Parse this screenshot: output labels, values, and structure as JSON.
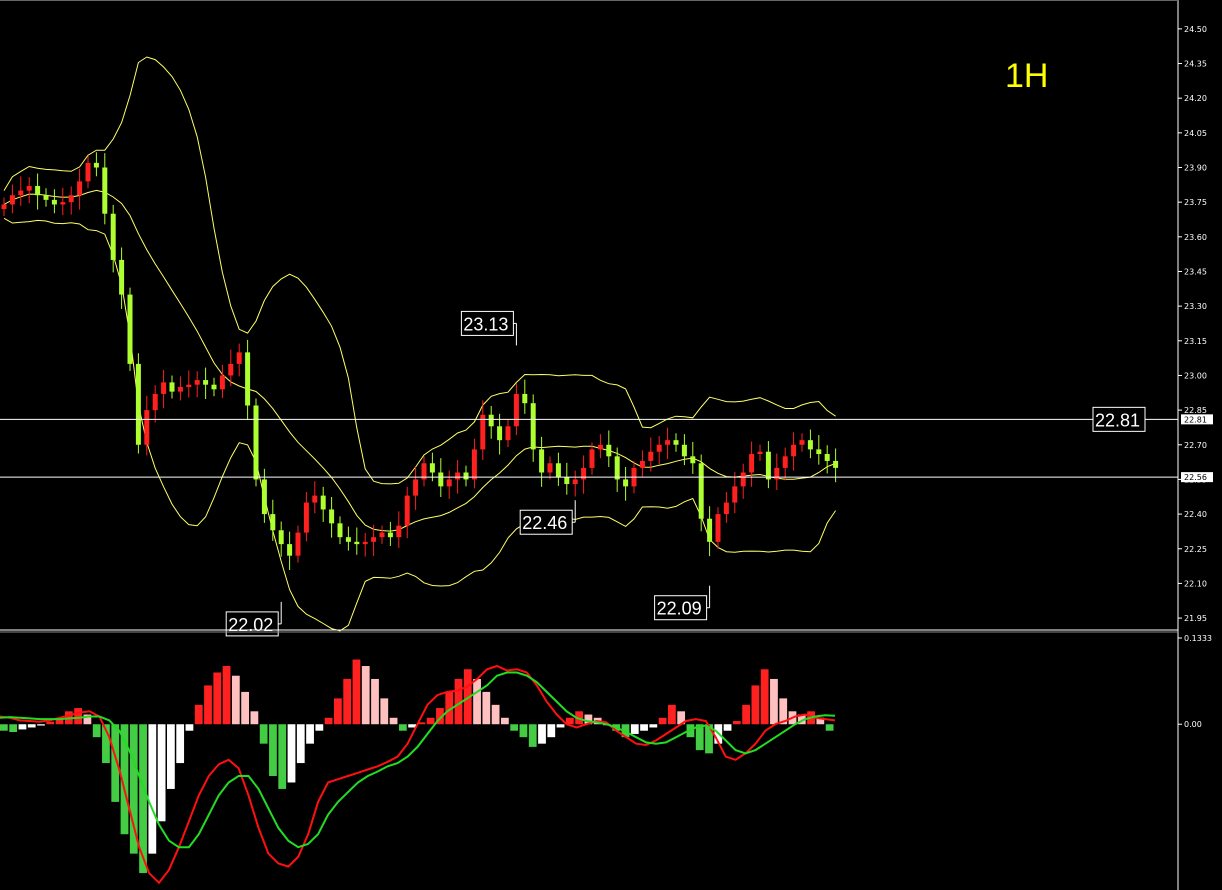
{
  "timeframe": "1H",
  "chart_data": [
    {
      "type": "candlestick",
      "title": "",
      "y_ticks": [
        24.5,
        24.35,
        24.2,
        24.05,
        23.9,
        23.75,
        23.6,
        23.45,
        23.3,
        23.15,
        23.0,
        22.85,
        22.7,
        22.55,
        22.4,
        22.25,
        22.1,
        21.95
      ],
      "ylim": [
        21.92,
        24.56
      ],
      "horizontal_lines": [
        {
          "price": 22.81,
          "label": "22.81",
          "tag": "22.81"
        },
        {
          "price": 22.56,
          "tag": "22.56"
        }
      ],
      "annotations": [
        {
          "text": "23.13",
          "price": 23.13,
          "bar": 61
        },
        {
          "text": "22.46",
          "price": 22.46,
          "bar": 68
        },
        {
          "text": "22.09",
          "price": 22.09,
          "bar": 84
        },
        {
          "text": "22.02",
          "price": 22.02,
          "bar": 33
        }
      ],
      "close_series": [
        23.74,
        23.78,
        23.8,
        23.82,
        23.78,
        23.76,
        23.74,
        23.75,
        23.78,
        23.84,
        23.92,
        23.9,
        23.7,
        23.5,
        23.35,
        23.05,
        22.7,
        22.85,
        22.92,
        22.97,
        22.93,
        22.95,
        22.96,
        22.98,
        22.96,
        22.94,
        23.0,
        23.05,
        23.1,
        22.87,
        22.55,
        22.4,
        22.33,
        22.27,
        22.22,
        22.32,
        22.45,
        22.48,
        22.42,
        22.36,
        22.3,
        22.28,
        22.27,
        22.28,
        22.3,
        22.32,
        22.3,
        22.35,
        22.48,
        22.55,
        22.62,
        22.58,
        22.52,
        22.55,
        22.58,
        22.55,
        22.68,
        22.83,
        22.78,
        22.72,
        22.78,
        22.92,
        22.88,
        22.68,
        22.58,
        22.62,
        22.56,
        22.53,
        22.55,
        22.6,
        22.68,
        22.7,
        22.65,
        22.55,
        22.52,
        22.6,
        22.63,
        22.67,
        22.7,
        22.72,
        22.7,
        22.65,
        22.62,
        22.38,
        22.28,
        22.4,
        22.45,
        22.52,
        22.58,
        22.66,
        22.67,
        22.55,
        22.6,
        22.65,
        22.7,
        22.72,
        22.68,
        22.66,
        22.63,
        22.6
      ]
    },
    {
      "type": "macd",
      "y_ticks": [
        0.1333,
        0.0
      ],
      "ylim": [
        -0.25,
        0.1333
      ],
      "macd": [
        0.012,
        0.01,
        0.006,
        0.005,
        0.004,
        0.006,
        0.01,
        0.014,
        0.018,
        0.02,
        0.012,
        -0.02,
        -0.07,
        -0.13,
        -0.19,
        -0.23,
        -0.245,
        -0.225,
        -0.19,
        -0.15,
        -0.11,
        -0.08,
        -0.062,
        -0.055,
        -0.068,
        -0.11,
        -0.16,
        -0.2,
        -0.215,
        -0.22,
        -0.205,
        -0.17,
        -0.12,
        -0.09,
        -0.085,
        -0.08,
        -0.075,
        -0.07,
        -0.065,
        -0.058,
        -0.05,
        -0.03,
        0.0,
        0.03,
        0.045,
        0.05,
        0.052,
        0.058,
        0.07,
        0.085,
        0.09,
        0.083,
        0.085,
        0.08,
        0.06,
        0.035,
        0.015,
        0.0,
        -0.005,
        0.0,
        0.005,
        0.003,
        -0.01,
        -0.02,
        -0.03,
        -0.032,
        -0.025,
        -0.015,
        -0.005,
        0.005,
        0.008,
        0.005,
        -0.02,
        -0.05,
        -0.055,
        -0.045,
        -0.03,
        -0.01,
        0.0,
        0.005,
        0.012,
        0.015,
        0.01,
        0.008,
        0.006
      ],
      "signal": [
        0.01,
        0.011,
        0.01,
        0.009,
        0.008,
        0.008,
        0.008,
        0.009,
        0.01,
        0.012,
        0.012,
        0.006,
        -0.01,
        -0.04,
        -0.08,
        -0.12,
        -0.155,
        -0.18,
        -0.19,
        -0.19,
        -0.17,
        -0.14,
        -0.11,
        -0.09,
        -0.08,
        -0.08,
        -0.1,
        -0.13,
        -0.16,
        -0.18,
        -0.19,
        -0.185,
        -0.17,
        -0.14,
        -0.12,
        -0.105,
        -0.09,
        -0.08,
        -0.073,
        -0.065,
        -0.06,
        -0.05,
        -0.035,
        -0.015,
        0.005,
        0.02,
        0.03,
        0.04,
        0.05,
        0.06,
        0.075,
        0.08,
        0.08,
        0.075,
        0.065,
        0.05,
        0.035,
        0.02,
        0.01,
        0.005,
        0.003,
        0.0,
        -0.005,
        -0.012,
        -0.02,
        -0.028,
        -0.03,
        -0.028,
        -0.02,
        -0.012,
        -0.005,
        -0.002,
        -0.01,
        -0.025,
        -0.04,
        -0.045,
        -0.04,
        -0.03,
        -0.02,
        -0.01,
        0.0,
        0.008,
        0.012,
        0.014,
        0.013
      ],
      "histogram": [
        -0.01,
        -0.012,
        -0.008,
        -0.005,
        -0.002,
        0.004,
        0.01,
        0.02,
        0.025,
        0.015,
        -0.02,
        -0.06,
        -0.12,
        -0.17,
        -0.2,
        -0.23,
        -0.2,
        -0.15,
        -0.1,
        -0.06,
        -0.01,
        0.03,
        0.06,
        0.08,
        0.09,
        0.075,
        0.05,
        0.02,
        -0.03,
        -0.08,
        -0.1,
        -0.09,
        -0.06,
        -0.03,
        -0.01,
        0.01,
        0.04,
        0.07,
        0.1,
        0.09,
        0.07,
        0.04,
        0.01,
        -0.01,
        -0.005,
        0.003,
        0.01,
        0.025,
        0.05,
        0.07,
        0.085,
        0.07,
        0.05,
        0.03,
        0.01,
        -0.01,
        -0.02,
        -0.035,
        -0.03,
        -0.02,
        -0.005,
        0.01,
        0.02,
        0.015,
        0.01,
        0.0,
        -0.01,
        -0.02,
        -0.015,
        -0.01,
        -0.005,
        0.01,
        0.03,
        0.02,
        -0.02,
        -0.04,
        -0.045,
        -0.03,
        -0.01,
        0.005,
        0.03,
        0.06,
        0.085,
        0.07,
        0.04,
        0.02,
        0.015,
        0.02,
        0.01,
        -0.01
      ]
    }
  ],
  "colors": {
    "background": "#000000",
    "up_candle": "#ff2020",
    "down_candle": "#adff2f",
    "bands": "#ffff66",
    "hist_pos_rising": "#ff2020",
    "hist_pos_falling": "#ffc0c0",
    "hist_neg_falling": "#44cc44",
    "hist_neg_rising": "#ffffff",
    "macd_line": "#ff1010",
    "signal_line": "#22dd22",
    "axis": "#ffffff"
  }
}
